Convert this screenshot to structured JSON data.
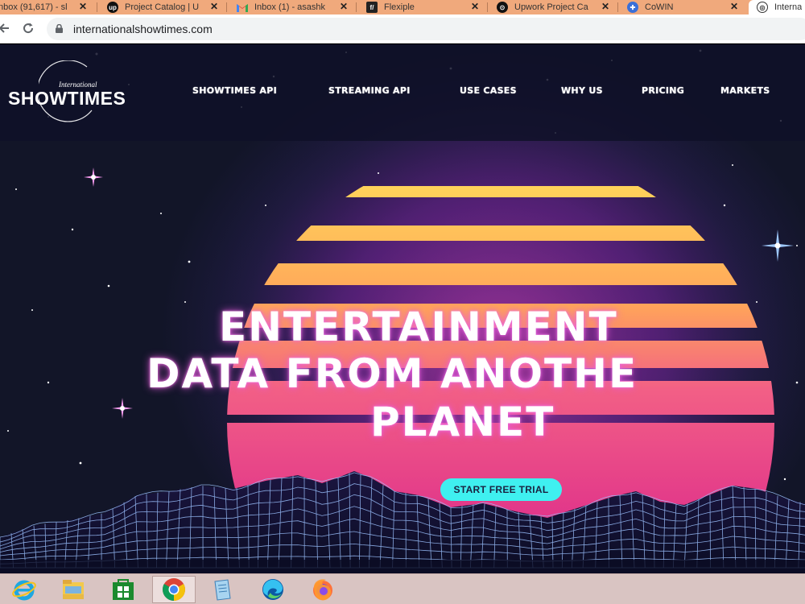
{
  "browser": {
    "tabs": [
      {
        "title": "nbox (91,617) - sl",
        "icon": "gmail-icon"
      },
      {
        "title": "Project Catalog | U",
        "icon": "upwork-icon"
      },
      {
        "title": "Inbox (1) - asashk",
        "icon": "gmail-icon"
      },
      {
        "title": "Flexiple",
        "icon": "flexiple-icon"
      },
      {
        "title": "Upwork Project Ca",
        "icon": "upwork-icon"
      },
      {
        "title": "CoWIN",
        "icon": "cowin-icon"
      },
      {
        "title": "Interna",
        "icon": "showtimes-icon"
      }
    ],
    "close_glyph": "✕",
    "url": "internationalshowtimes.com"
  },
  "site": {
    "logo": {
      "small": "International",
      "brand": "SHOWTIMES"
    },
    "nav": [
      "SHOWTIMES API",
      "STREAMING API",
      "USE CASES",
      "WHY US",
      "PRICING",
      "MARKETS"
    ],
    "hero": {
      "line1": "ENTERTAINMENT",
      "line2": "DATA FROM ANOTHE",
      "line3": "PLANET"
    },
    "cta": "START FREE TRIAL",
    "colors": {
      "cta": "#3ff0f0",
      "sun_top": "#ffd35a",
      "sun_bottom": "#e0338a",
      "grid": "#8fb6ff"
    }
  },
  "taskbar": {
    "apps": [
      {
        "name": "internet-explorer-icon",
        "active": false
      },
      {
        "name": "file-explorer-icon",
        "active": false
      },
      {
        "name": "store-icon",
        "active": false
      },
      {
        "name": "chrome-icon",
        "active": true
      },
      {
        "name": "notepad-icon",
        "active": false
      },
      {
        "name": "edge-icon",
        "active": false
      },
      {
        "name": "firefox-icon",
        "active": false
      }
    ]
  }
}
